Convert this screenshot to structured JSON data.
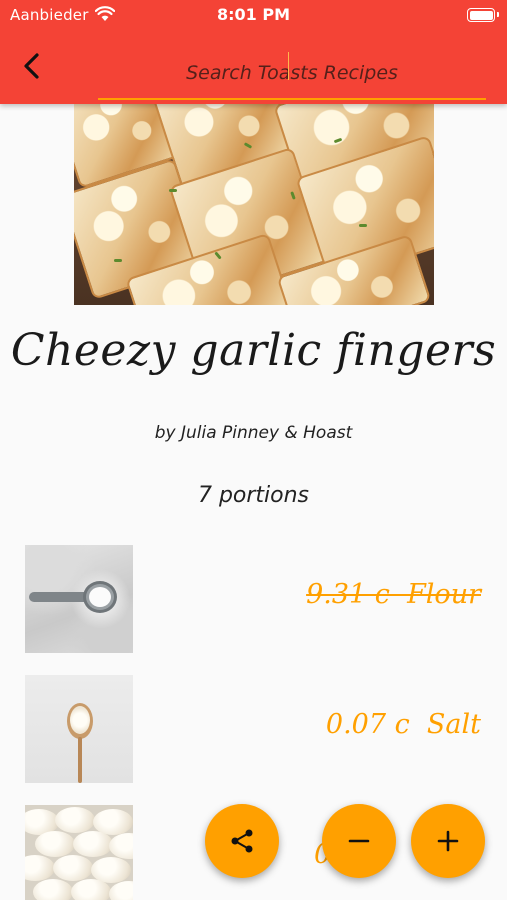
{
  "status_bar": {
    "carrier": "Aanbieder",
    "time": "8:01 PM"
  },
  "header": {
    "search_placeholder": "Search Toasts Recipes",
    "background_color": "#f44336",
    "underline_color": "#ffa000"
  },
  "recipe": {
    "title": "Cheezy garlic fingers",
    "author": "by Julia Pinney & Hoast",
    "portions": "7 portions"
  },
  "ingredients": [
    {
      "text": "9.31 c  Flour",
      "crossed_out": true
    },
    {
      "text": "0.07 c  Salt",
      "crossed_out": false
    },
    {
      "text": "0.2",
      "crossed_out": false
    }
  ],
  "fabs": {
    "share_icon": "share-icon",
    "minus_icon": "minus-icon",
    "plus_icon": "plus-icon",
    "color": "#ffa000"
  }
}
